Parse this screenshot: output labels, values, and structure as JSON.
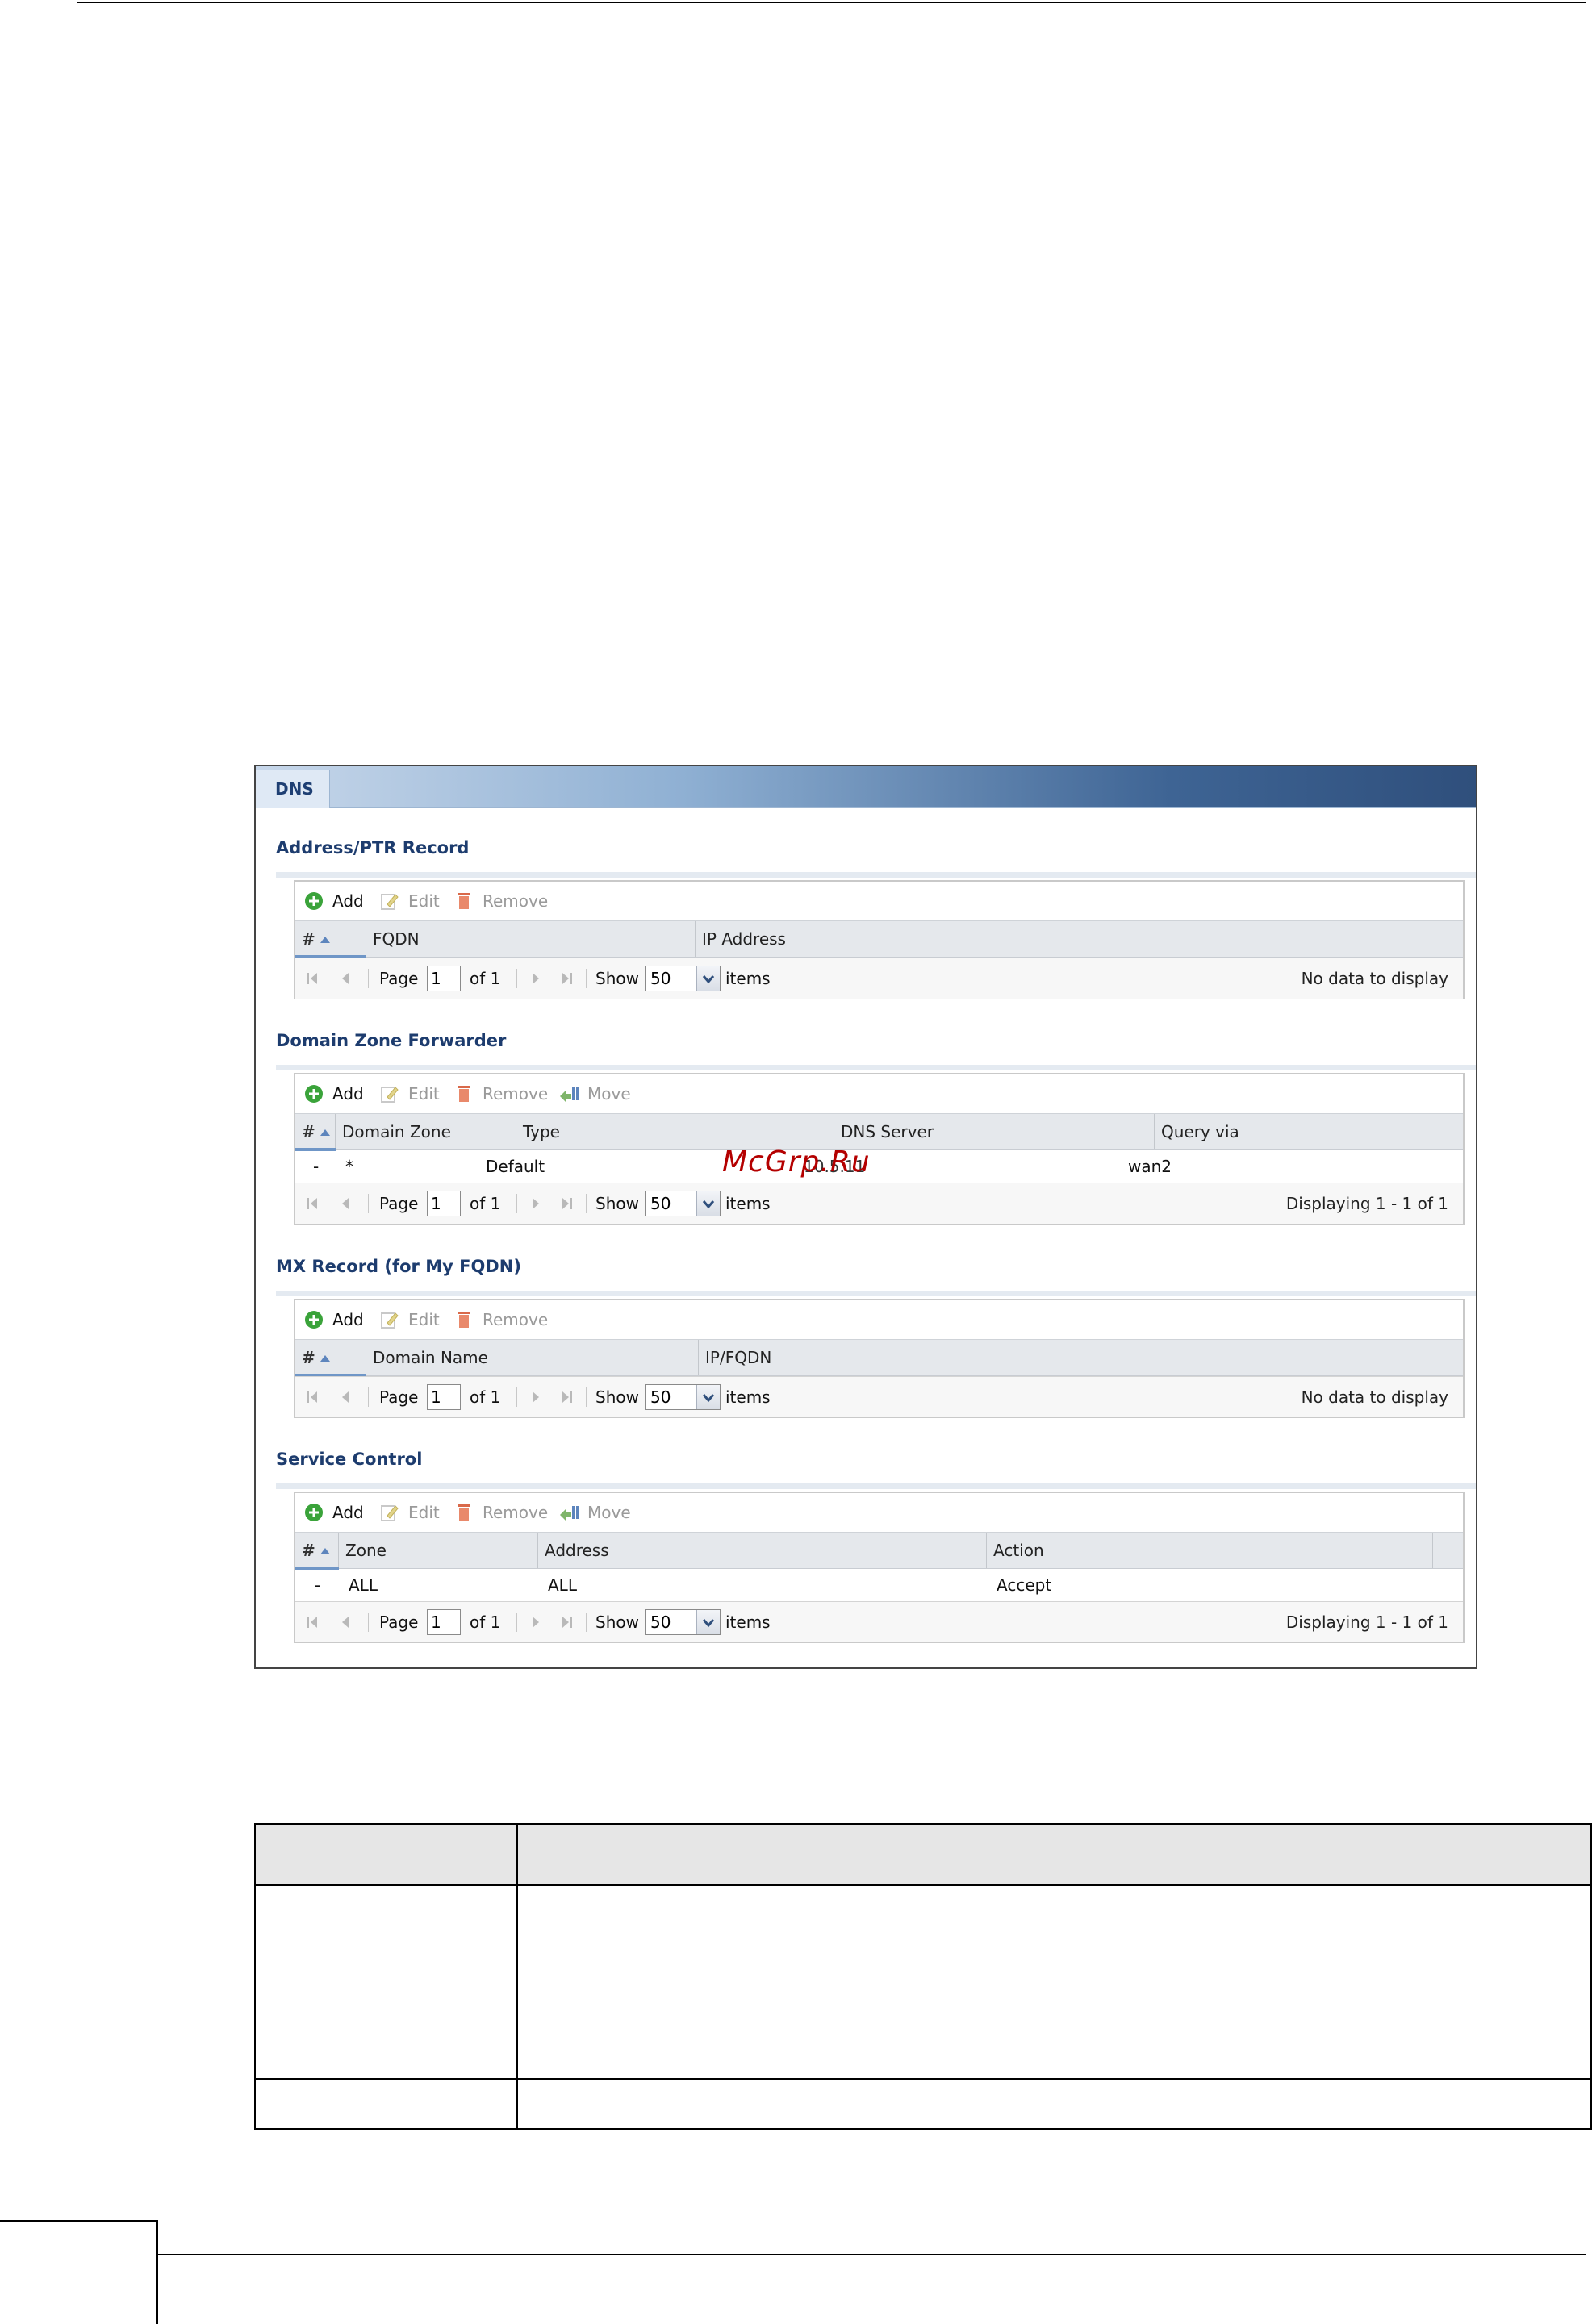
{
  "watermark": "McGrp.Ru",
  "dns_panel": {
    "tab": "DNS",
    "sections": {
      "address_ptr": {
        "title": "Address/PTR Record",
        "toolbar": {
          "add": "Add",
          "edit": "Edit",
          "remove": "Remove"
        },
        "columns": [
          "#",
          "FQDN",
          "IP Address"
        ],
        "pager": {
          "page_label": "Page",
          "page_value": "1",
          "of_label": "of 1",
          "show_label": "Show",
          "show_value": "50",
          "items_label": "items",
          "status": "No data to display"
        }
      },
      "domain_zone": {
        "title": "Domain Zone Forwarder",
        "toolbar": {
          "add": "Add",
          "edit": "Edit",
          "remove": "Remove",
          "move": "Move"
        },
        "columns": [
          "#",
          "Domain Zone",
          "Type",
          "DNS Server",
          "Query via"
        ],
        "rows": [
          {
            "num": "-",
            "zone": "*",
            "type": "Default",
            "server": "10.5.11",
            "query": "wan2"
          }
        ],
        "pager": {
          "page_label": "Page",
          "page_value": "1",
          "of_label": "of 1",
          "show_label": "Show",
          "show_value": "50",
          "items_label": "items",
          "status": "Displaying 1 - 1 of 1"
        }
      },
      "mx_record": {
        "title": "MX Record (for My FQDN)",
        "toolbar": {
          "add": "Add",
          "edit": "Edit",
          "remove": "Remove"
        },
        "columns": [
          "#",
          "Domain Name",
          "IP/FQDN"
        ],
        "pager": {
          "page_label": "Page",
          "page_value": "1",
          "of_label": "of 1",
          "show_label": "Show",
          "show_value": "50",
          "items_label": "items",
          "status": "No data to display"
        }
      },
      "service_control": {
        "title": "Service Control",
        "toolbar": {
          "add": "Add",
          "edit": "Edit",
          "remove": "Remove",
          "move": "Move"
        },
        "columns": [
          "#",
          "Zone",
          "Address",
          "Action"
        ],
        "rows": [
          {
            "num": "-",
            "zone": "ALL",
            "address": "ALL",
            "action": "Accept"
          }
        ],
        "pager": {
          "page_label": "Page",
          "page_value": "1",
          "of_label": "of 1",
          "show_label": "Show",
          "show_value": "50",
          "items_label": "items",
          "status": "Displaying 1 - 1 of 1"
        }
      }
    }
  },
  "colors": {
    "header_dark": "#2f4f7c",
    "section_title": "#1d3c6e",
    "add_green": "#3aa33a",
    "remove_red": "#d9694a"
  }
}
